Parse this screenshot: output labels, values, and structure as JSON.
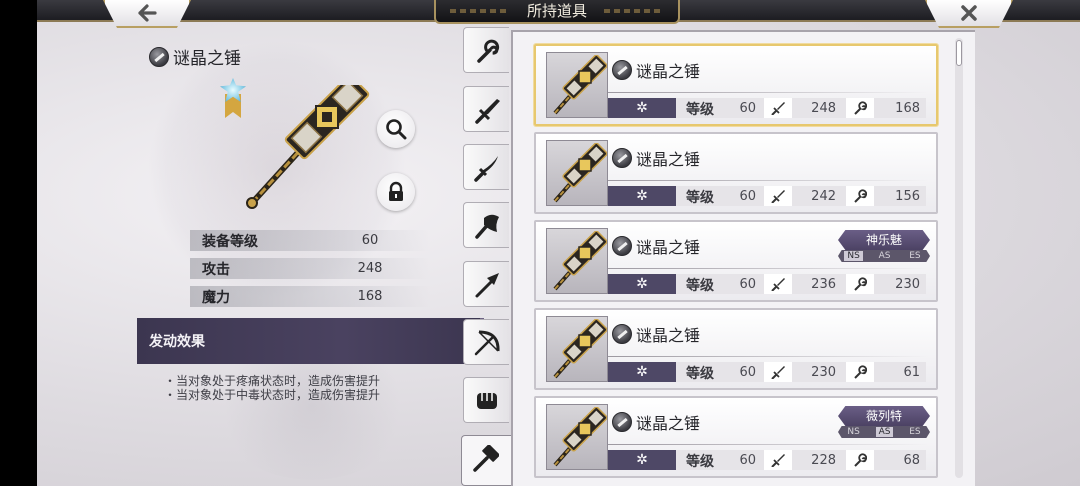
{
  "header": {
    "title": "所持道具",
    "back_icon": "back-arrow-icon",
    "close_icon": "close-icon"
  },
  "detail": {
    "name": "谜晶之锤",
    "element_icon": "shadow-element-icon",
    "rank_icon": "crystal-rank-icon",
    "stats": [
      {
        "label": "装备等级",
        "value": "60"
      },
      {
        "label": "攻击",
        "value": "248"
      },
      {
        "label": "魔力",
        "value": "168"
      }
    ],
    "effect_title": "发动效果",
    "effects": [
      "・当对象处于疼痛状态时，造成伤害提升",
      "・当对象处于中毒状态时，造成伤害提升"
    ],
    "zoom_icon": "magnifier-icon",
    "lock_icon": "lock-icon"
  },
  "tabs": [
    {
      "icon": "staff-icon",
      "active": false
    },
    {
      "icon": "sword-icon",
      "active": false
    },
    {
      "icon": "katana-icon",
      "active": false
    },
    {
      "icon": "axe-icon",
      "active": false
    },
    {
      "icon": "spear-icon",
      "active": false
    },
    {
      "icon": "bow-icon",
      "active": false
    },
    {
      "icon": "fist-icon",
      "active": false
    },
    {
      "icon": "hammer-icon",
      "active": true
    }
  ],
  "list": {
    "level_label": "等级",
    "element_symbol": "✲",
    "items": [
      {
        "name": "谜晶之锤",
        "level": "60",
        "attack": "248",
        "magic": "168",
        "owner": "",
        "selected": true
      },
      {
        "name": "谜晶之锤",
        "level": "60",
        "attack": "242",
        "magic": "156",
        "owner": "",
        "selected": false
      },
      {
        "name": "谜晶之锤",
        "level": "60",
        "attack": "236",
        "magic": "230",
        "owner": "神乐魅",
        "versions": [
          "NS",
          "AS",
          "ES"
        ],
        "active_version": "NS",
        "selected": false
      },
      {
        "name": "谜晶之锤",
        "level": "60",
        "attack": "230",
        "magic": "61",
        "owner": "",
        "selected": false
      },
      {
        "name": "谜晶之锤",
        "level": "60",
        "attack": "228",
        "magic": "68",
        "owner": "薇列特",
        "versions": [
          "NS",
          "AS",
          "ES"
        ],
        "active_version": "AS",
        "selected": false
      }
    ]
  },
  "colors": {
    "accent_gold": "#b89f62",
    "element_purple": "#4e4866",
    "panel_dark": "#3c3650"
  }
}
